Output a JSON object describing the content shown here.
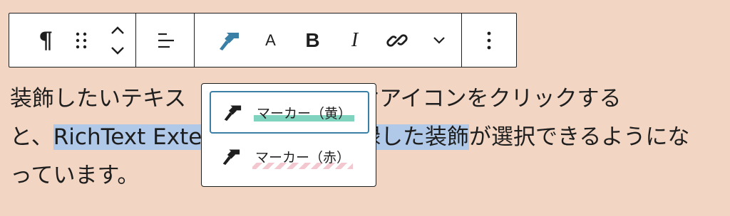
{
  "toolbar": {
    "paragraph_icon": "¶",
    "drag_icon": "drag-handle-icon",
    "move_icon": "chevron-up-down-icon",
    "align_icon": "align-left-icon",
    "brush_icon": "paint-brush-icon",
    "accent_color": "#3a7fa6",
    "font_size_label": "A",
    "bold_label": "B",
    "italic_label": "I",
    "link_icon": "link-icon",
    "more_format_icon": "chevron-down-icon",
    "options_icon": "vertical-ellipsis-icon"
  },
  "content": {
    "part1": "装飾したいテキス",
    "part2": "でハケアイコンをクリックする",
    "part3": "と、",
    "selected": "RichText Exten",
    "selected_tail": "録した装飾",
    "part4": "が選択できるようにな",
    "part5": "っています。",
    "selection_color": "#b0c9e8"
  },
  "popover": {
    "items": [
      {
        "label": "マーカー（黄）",
        "icon": "paint-brush-icon",
        "marker_color": "#7fd3bf"
      },
      {
        "label": "マーカー（赤）",
        "icon": "paint-brush-icon",
        "marker_color": "#f3c7cf"
      }
    ]
  },
  "background_color": "#f2d5c2"
}
